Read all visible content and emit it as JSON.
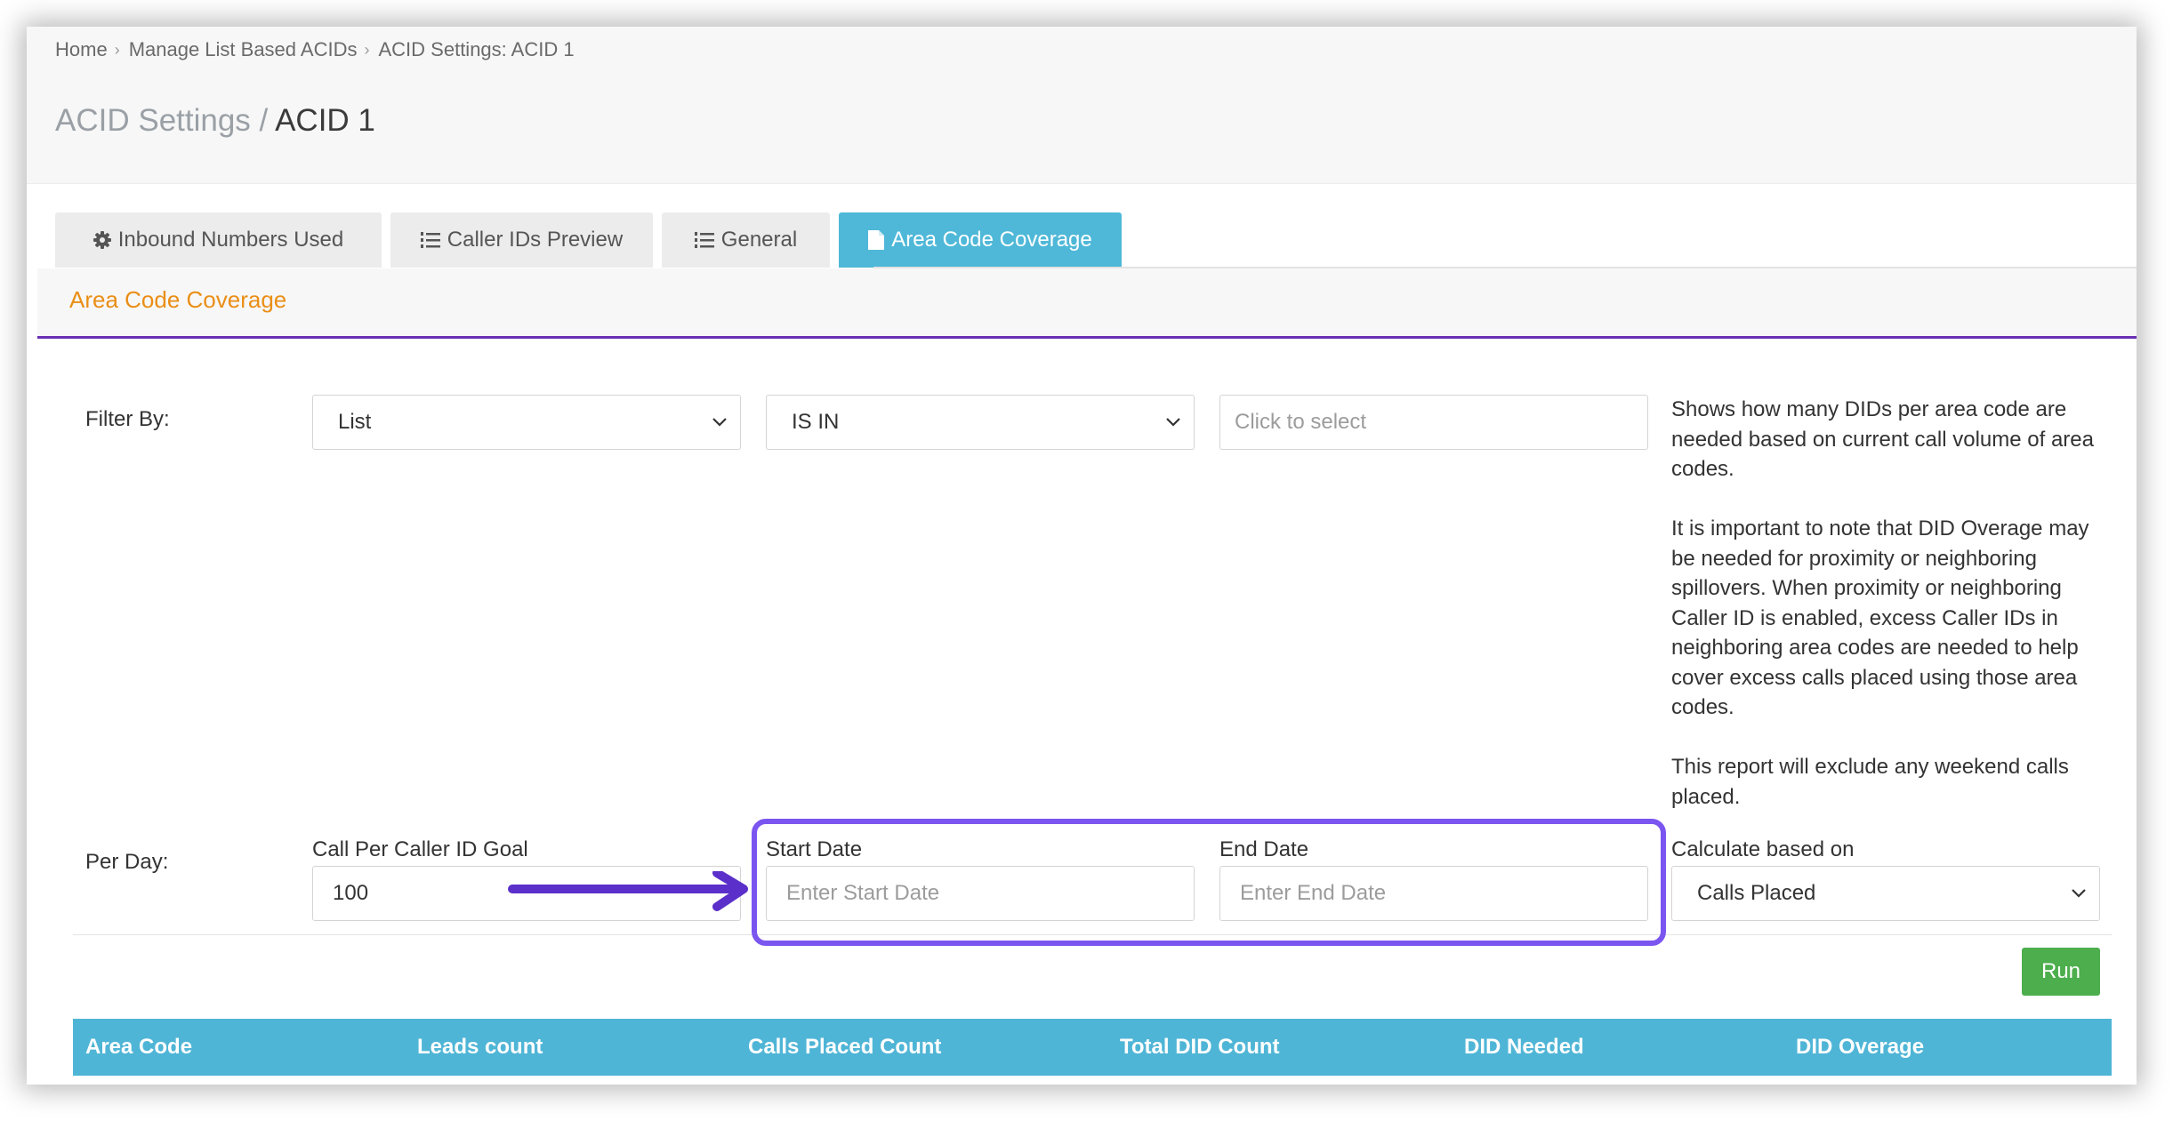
{
  "breadcrumb": {
    "items": [
      "Home",
      "Manage List Based ACIDs",
      "ACID Settings: ACID 1"
    ]
  },
  "page_title": {
    "prefix": "ACID Settings",
    "separator": "/",
    "current": "ACID 1"
  },
  "tabs": [
    {
      "label": "Inbound Numbers Used",
      "icon": "gear-icon",
      "active": false
    },
    {
      "label": "Caller IDs Preview",
      "icon": "list-ordered-icon",
      "active": false
    },
    {
      "label": "General",
      "icon": "list-ordered-icon",
      "active": false
    },
    {
      "label": "Area Code Coverage",
      "icon": "file-icon",
      "active": true
    }
  ],
  "section": {
    "title": "Area Code Coverage"
  },
  "filter": {
    "label": "Filter By:",
    "field": "List",
    "operator": "IS IN",
    "value_placeholder": "Click to select"
  },
  "help_text": [
    "Shows how many DIDs per area code are needed based on current call volume of area codes.",
    "It is important to note that DID Overage may be needed for proximity or neighboring spillovers. When proximity or neighboring Caller ID is enabled, excess Caller IDs in neighboring area codes are needed to help cover excess calls placed using those area codes.",
    "This report will exclude any weekend calls placed."
  ],
  "per_day": {
    "label": "Per Day:",
    "goal_label": "Call Per Caller ID Goal",
    "goal_value": "100",
    "start_label": "Start Date",
    "start_placeholder": "Enter Start Date",
    "end_label": "End Date",
    "end_placeholder": "Enter End Date",
    "calc_label": "Calculate based on",
    "calc_value": "Calls Placed"
  },
  "run_button": "Run",
  "table": {
    "columns": [
      "Area Code",
      "Leads count",
      "Calls Placed Count",
      "Total DID Count",
      "DID Needed",
      "DID Overage"
    ]
  },
  "colors": {
    "tab_active": "#4fb8d8",
    "section_title": "#ea8e16",
    "section_rule": "#6a2fb3",
    "run_button": "#4cae4c",
    "table_header": "#4fb5d6",
    "annotation": "#7b55f0"
  }
}
